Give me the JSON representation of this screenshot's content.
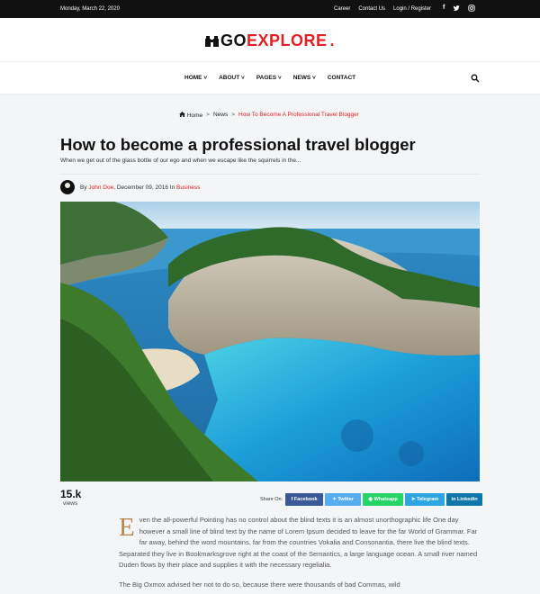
{
  "topbar": {
    "date": "Monday, March 22, 2020",
    "links": [
      "Career",
      "Contact Us",
      "Login / Register"
    ],
    "social_icons": [
      "facebook-icon",
      "twitter-icon",
      "instagram-icon"
    ]
  },
  "logo": {
    "part1": "GO",
    "part2": "EXPLORE",
    "dot": ".",
    "icon": "binoculars-icon"
  },
  "nav": {
    "items": [
      {
        "label": "HOME",
        "dropdown": true
      },
      {
        "label": "ABOUT",
        "dropdown": true
      },
      {
        "label": "PAGES",
        "dropdown": true
      },
      {
        "label": "NEWS",
        "dropdown": true
      },
      {
        "label": "CONTACT",
        "dropdown": false
      }
    ],
    "search_icon": "search-icon"
  },
  "breadcrumb": {
    "home": "Home",
    "section": "News",
    "current": "How To Become A Professional Travel Blogger",
    "sep": ">"
  },
  "post": {
    "title": "How to become a professional travel blogger",
    "subtitle": "When we get out of the glass bottle of our ego and when we escape like the squirrels in the...",
    "by": "By",
    "author": "John Doe,",
    "date": "December 09, 2016",
    "in": "In",
    "category": "Business"
  },
  "views": {
    "count": "15.k",
    "label": "views"
  },
  "share": {
    "label": "Share On:",
    "facebook": "Facebook",
    "twitter": "Twitter",
    "whatsapp": "Whatsapp",
    "telegram": "Telegram",
    "linkedin": "Linkedin"
  },
  "article": {
    "dropcap": "E",
    "p1": "ven the all-powerful Pointing has no control about the blind texts it is an almost unorthographic life One day however a small line of blind text by the name of Lorem Ipsum decided to leave for the far World of Grammar. Far far away, behind the word mountains, far from the countries Vokalia and Consonantia, there live the blind texts. Separated they live in Bookmarksgrove right at the coast of the Semantics, a large language ocean. A small river named Duden flows by their place and supplies it with the necessary regelialia.",
    "p2": "The Big Oxmox advised her not to do so, because there were thousands of bad Commas, wild"
  },
  "colors": {
    "accent": "#e31e24",
    "topbar": "#111111",
    "dropcap": "#b6864d",
    "facebook": "#3b5998",
    "twitter": "#55acee",
    "whatsapp": "#25d366",
    "telegram": "#2ca5e0",
    "linkedin": "#0e76a8"
  }
}
